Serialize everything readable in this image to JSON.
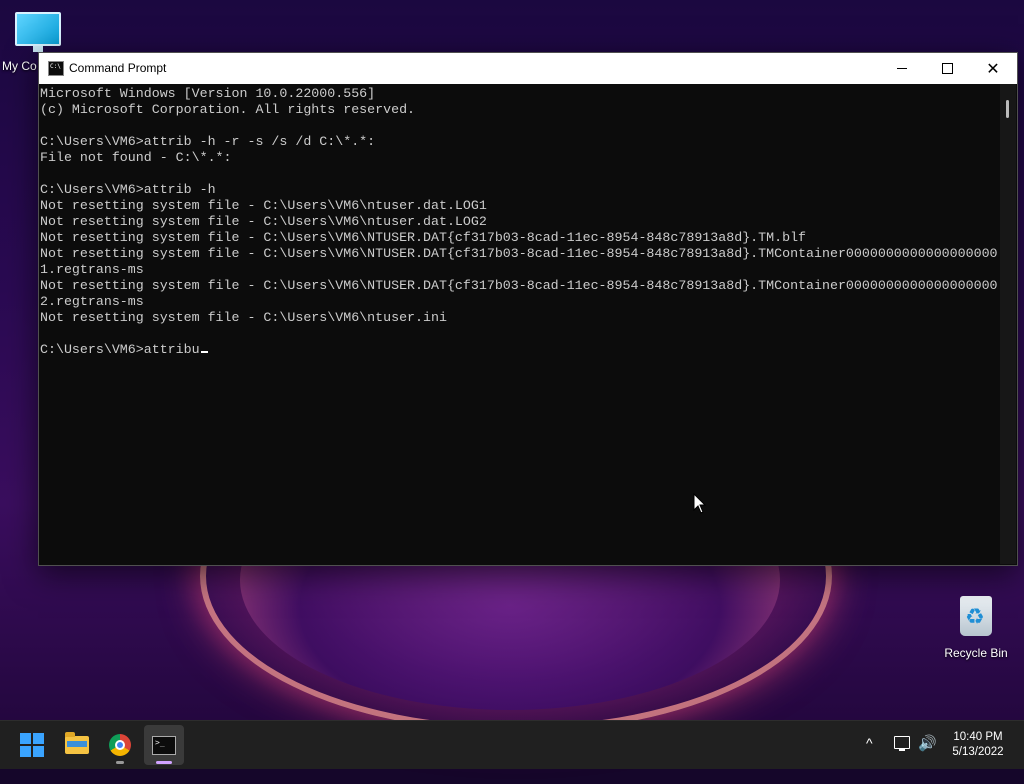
{
  "desktop": {
    "icons": [
      {
        "label": "My Co",
        "icon": "monitor-icon"
      },
      {
        "label": "Recycle Bin",
        "icon": "recycle-bin-icon"
      }
    ]
  },
  "window": {
    "title": "Command Prompt",
    "icon": "cmd-icon",
    "controls": {
      "minimize": "minimize-icon",
      "maximize": "maximize-icon",
      "close": "close-icon"
    }
  },
  "console": {
    "lines": [
      "Microsoft Windows [Version 10.0.22000.556]",
      "(c) Microsoft Corporation. All rights reserved.",
      "",
      "C:\\Users\\VM6>attrib -h -r -s /s /d C:\\*.*:",
      "File not found - C:\\*.*:",
      "",
      "C:\\Users\\VM6>attrib -h",
      "Not resetting system file - C:\\Users\\VM6\\ntuser.dat.LOG1",
      "Not resetting system file - C:\\Users\\VM6\\ntuser.dat.LOG2",
      "Not resetting system file - C:\\Users\\VM6\\NTUSER.DAT{cf317b03-8cad-11ec-8954-848c78913a8d}.TM.blf",
      "Not resetting system file - C:\\Users\\VM6\\NTUSER.DAT{cf317b03-8cad-11ec-8954-848c78913a8d}.TMContainer0000000000000000000",
      "1.regtrans-ms",
      "Not resetting system file - C:\\Users\\VM6\\NTUSER.DAT{cf317b03-8cad-11ec-8954-848c78913a8d}.TMContainer0000000000000000000",
      "2.regtrans-ms",
      "Not resetting system file - C:\\Users\\VM6\\ntuser.ini",
      ""
    ],
    "prompt_line": "C:\\Users\\VM6>attribu"
  },
  "taskbar": {
    "apps": [
      {
        "name": "Start",
        "icon": "windows-start-icon"
      },
      {
        "name": "File Explorer",
        "icon": "folder-icon"
      },
      {
        "name": "Google Chrome",
        "icon": "chrome-icon"
      },
      {
        "name": "Command Prompt",
        "icon": "cmd-icon"
      }
    ],
    "tray": {
      "chevron": "^",
      "volume": "🔊"
    },
    "clock": {
      "time": "10:40 PM",
      "date": "5/13/2022"
    }
  }
}
